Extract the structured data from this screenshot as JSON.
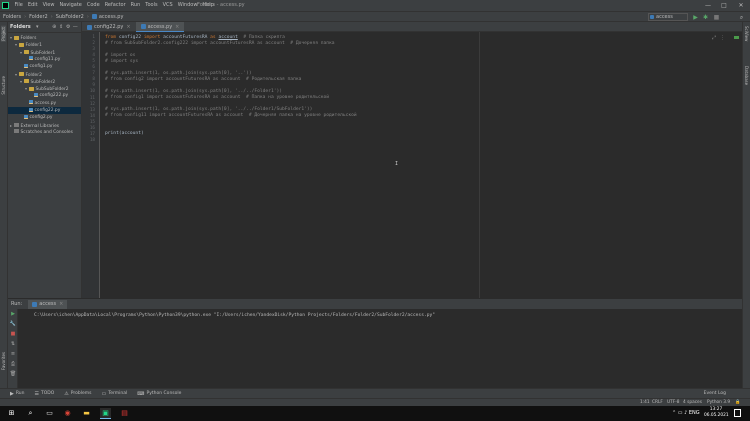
{
  "window": {
    "title": "Folders - access.py",
    "menu": [
      "File",
      "Edit",
      "View",
      "Navigate",
      "Code",
      "Refactor",
      "Run",
      "Tools",
      "VCS",
      "Window",
      "Help"
    ],
    "controls": {
      "minimize": "—",
      "maximize": "□",
      "close": "✕"
    }
  },
  "navbar": {
    "breadcrumbs": [
      "Folders",
      "Folder2",
      "SubFolder2",
      "access.py"
    ],
    "run_config": "access",
    "run_icon": "▶",
    "debug_icon": "✱",
    "stop_icon": "■",
    "search_icon": "⌕"
  },
  "project": {
    "title": "Folders",
    "tree": [
      {
        "label": "Folders",
        "kind": "folder",
        "indent": 0,
        "caret": "▾",
        "selected": false
      },
      {
        "label": "Folder1",
        "kind": "folder",
        "indent": 1,
        "caret": "▾",
        "selected": false
      },
      {
        "label": "SubFolder1",
        "kind": "folder",
        "indent": 2,
        "caret": "▾",
        "selected": false
      },
      {
        "label": "config11.py",
        "kind": "py",
        "indent": 3,
        "caret": "",
        "selected": false
      },
      {
        "label": "config1.py",
        "kind": "py",
        "indent": 2,
        "caret": "",
        "selected": false
      },
      {
        "label": "Folder2",
        "kind": "folder",
        "indent": 1,
        "caret": "▾",
        "selected": false
      },
      {
        "label": "SubFolder2",
        "kind": "folder",
        "indent": 2,
        "caret": "▾",
        "selected": false
      },
      {
        "label": "SubSubFolder2",
        "kind": "folder",
        "indent": 3,
        "caret": "▾",
        "selected": false
      },
      {
        "label": "config222.py",
        "kind": "py",
        "indent": 4,
        "caret": "",
        "selected": false
      },
      {
        "label": "access.py",
        "kind": "py",
        "indent": 3,
        "caret": "",
        "selected": false
      },
      {
        "label": "config22.py",
        "kind": "py",
        "indent": 3,
        "caret": "",
        "selected": true
      },
      {
        "label": "config2.py",
        "kind": "py",
        "indent": 2,
        "caret": "",
        "selected": false
      },
      {
        "label": "External Libraries",
        "kind": "lib",
        "indent": 0,
        "caret": "▸",
        "selected": false
      },
      {
        "label": "Scratches and Consoles",
        "kind": "lib",
        "indent": 0,
        "caret": "",
        "selected": false
      }
    ]
  },
  "editor": {
    "tabs": [
      {
        "label": "config22.py",
        "active": false,
        "close": "×"
      },
      {
        "label": "access.py",
        "active": true,
        "close": "×"
      }
    ],
    "lines": [
      {
        "n": "1",
        "segs": [
          {
            "t": "from ",
            "c": "kw"
          },
          {
            "t": "config22 ",
            "c": "plain"
          },
          {
            "t": "import ",
            "c": "kw"
          },
          {
            "t": "accountFuturesRA ",
            "c": "plain"
          },
          {
            "t": "as ",
            "c": "kw"
          },
          {
            "t": "account",
            "c": "plain ul"
          },
          {
            "t": "  # Папка скрипта",
            "c": "cm"
          }
        ]
      },
      {
        "n": "2",
        "segs": [
          {
            "t": "# from SubSubFolder2.config222 import accountFuturesRA as account  # Дочерняя папка",
            "c": "cm"
          }
        ]
      },
      {
        "n": "3",
        "segs": []
      },
      {
        "n": "4",
        "segs": [
          {
            "t": "# import os",
            "c": "cm"
          }
        ]
      },
      {
        "n": "5",
        "segs": [
          {
            "t": "# import sys",
            "c": "cm"
          }
        ]
      },
      {
        "n": "6",
        "segs": []
      },
      {
        "n": "7",
        "segs": [
          {
            "t": "# sys.path.insert(1, os.path.join(sys.path[0], '..'))",
            "c": "cm"
          }
        ]
      },
      {
        "n": "8",
        "segs": [
          {
            "t": "# from config2 import accountFuturesRA as account  # Родительская папка",
            "c": "cm"
          }
        ]
      },
      {
        "n": "9",
        "segs": []
      },
      {
        "n": "10",
        "segs": [
          {
            "t": "# sys.path.insert(1, os.path.join(sys.path[0], '../../Folder1'))",
            "c": "cm"
          }
        ]
      },
      {
        "n": "11",
        "segs": [
          {
            "t": "# from config1 import accountFuturesRA as account  # Папка на уровне родительской",
            "c": "cm"
          }
        ]
      },
      {
        "n": "12",
        "segs": []
      },
      {
        "n": "13",
        "segs": [
          {
            "t": "# sys.path.insert(1, os.path.join(sys.path[0], '../../Folder1/SubFolder1'))",
            "c": "cm"
          }
        ]
      },
      {
        "n": "14",
        "segs": [
          {
            "t": "# from config11 import accountFuturesRA as account  # Дочерняя папка на уровне родительской",
            "c": "cm"
          }
        ]
      },
      {
        "n": "15",
        "segs": []
      },
      {
        "n": "16",
        "segs": []
      },
      {
        "n": "17",
        "segs": [
          {
            "t": "print(account)",
            "c": "plain"
          }
        ]
      }
    ],
    "extra_line_numbers": [
      "18"
    ],
    "cursor_glyph": "I"
  },
  "run": {
    "label": "Run:",
    "tab": "access",
    "console": "C:\\Users\\ichen\\AppData\\Local\\Programs\\Python\\Python39\\python.exe \"I:/Users/ichen/YandexDisk/Python Projects/Folders/Folder2/SubFolder2/access.py\"",
    "toolbar": [
      "▶",
      "🔧",
      "■",
      "⇅",
      "≡",
      "⎙",
      "🗑"
    ]
  },
  "tool_tabs": [
    {
      "icon": "▶",
      "label": "Run"
    },
    {
      "icon": "☰",
      "label": "TODO"
    },
    {
      "icon": "⚠",
      "label": "Problems"
    },
    {
      "icon": "▭",
      "label": "Terminal"
    },
    {
      "icon": "⌨",
      "label": "Python Console"
    }
  ],
  "event_log": "Event Log",
  "status": {
    "position": "1:41",
    "line_sep": "CRLF",
    "encoding": "UTF-8",
    "indent": "4 spaces",
    "interpreter": "Python 3.9"
  },
  "side_labels": {
    "project": "Project",
    "structure": "Structure",
    "favorites": "Favorites",
    "scimode": "SciView",
    "database": "Database"
  },
  "taskbar": {
    "start": "⊞",
    "search": "⌕",
    "apps": [
      "▭",
      "◉",
      "▬",
      "▣",
      "▤"
    ],
    "time": "13:27",
    "date": "06.05.2021"
  },
  "colors": {
    "accent": "#4a88c7",
    "keyword": "#cc7832",
    "comment": "#808080",
    "plain": "#a9b7c6"
  }
}
